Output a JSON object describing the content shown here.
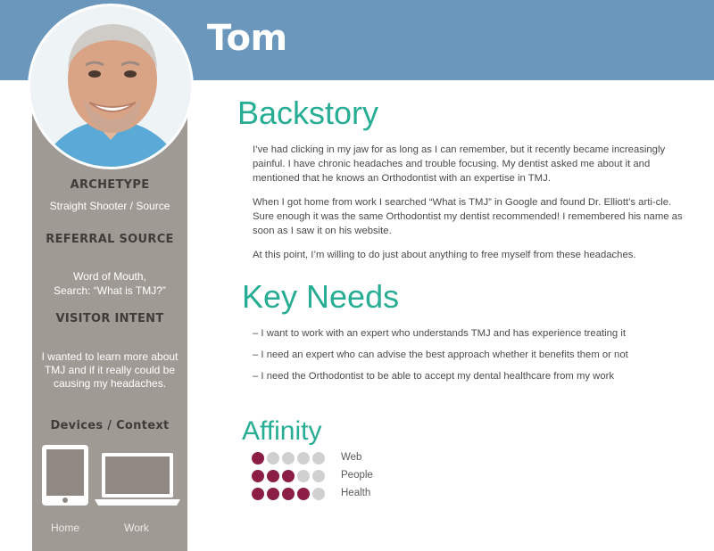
{
  "persona": {
    "name": "Tom"
  },
  "colors": {
    "header": "#6b97bd",
    "sidebar": "#a09a94",
    "accent": "#27ad93",
    "dot_filled": "#8c1d44",
    "dot_empty": "#d0d0d0"
  },
  "sidebar": {
    "archetype": {
      "heading": "ARCHETYPE",
      "value": "Straight Shooter / Source"
    },
    "referral": {
      "heading": "REFERRAL SOURCE",
      "line1": "Word of Mouth,",
      "line2": "Search: “What is TMJ?”"
    },
    "intent": {
      "heading": "VISITOR INTENT",
      "line1": "I wanted to learn more about",
      "line2": "TMJ and if it really could be",
      "line3": "causing my headaches."
    },
    "devices": {
      "heading": "Devices / Context",
      "tablet_label": "Home",
      "laptop_label": "Work",
      "tablet_icon": "tablet-icon",
      "laptop_icon": "laptop-icon"
    }
  },
  "backstory": {
    "heading": "Backstory",
    "paragraphs": [
      "I’ve had clicking in my jaw for as long as I can remember, but it recently became increasingly painful. I have chronic headaches and trouble focusing. My dentist asked me about it and mentioned that he knows an Orthodontist with an expertise in TMJ.",
      "When I got home from work I searched “What is TMJ” in Google and found Dr. Elliott’s arti-cle. Sure enough it was the same Orthodontist my dentist recommended! I remembered his name as soon as I saw it on his website.",
      "At this point, I’m willing to do just about anything to free myself from these headaches."
    ]
  },
  "key_needs": {
    "heading": "Key Needs",
    "items": [
      "– I want to work with an expert who understands TMJ and has experience treating it",
      "– I need an expert who can advise the best approach whether it benefits them or not",
      "– I need the Orthodontist to be able to accept my dental healthcare from my work"
    ]
  },
  "affinity": {
    "heading": "Affinity",
    "max": 5,
    "rows": [
      {
        "label": "Web",
        "level": 1
      },
      {
        "label": "People",
        "level": 3
      },
      {
        "label": "Health",
        "level": 4
      }
    ]
  }
}
